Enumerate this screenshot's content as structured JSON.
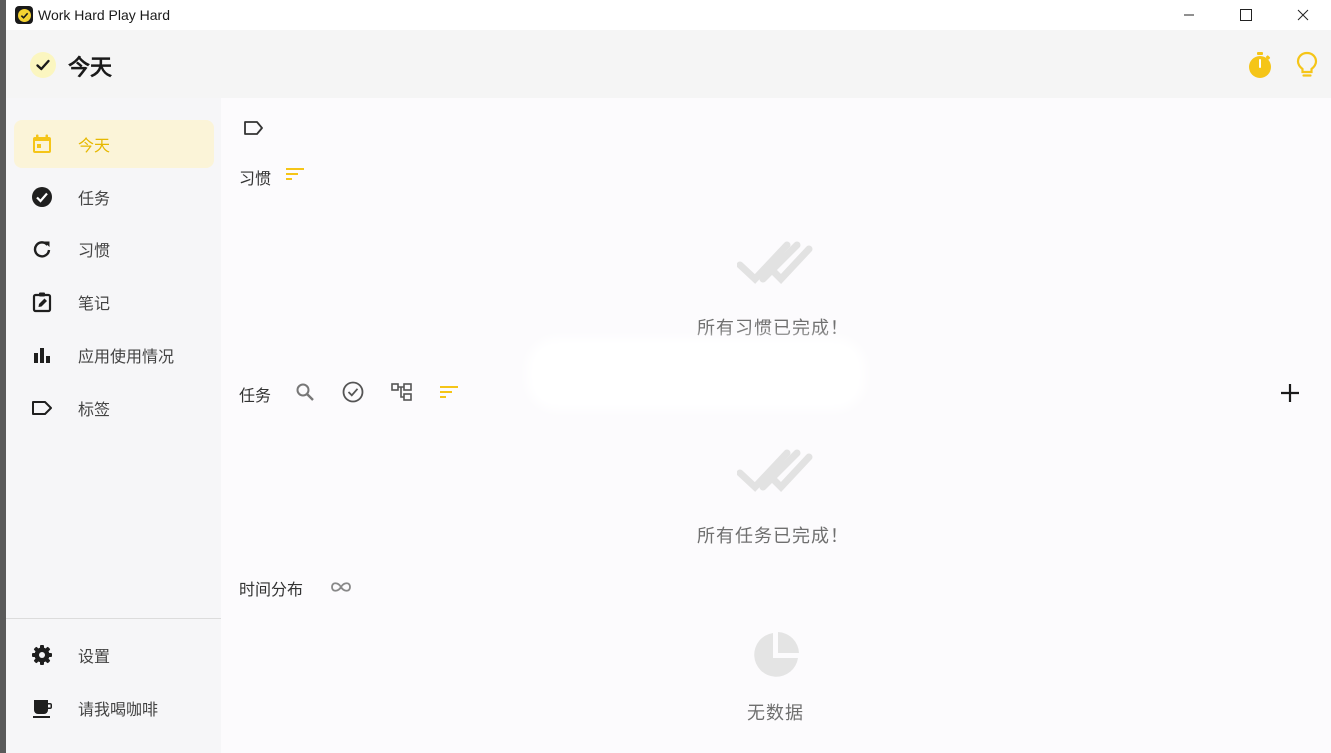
{
  "window": {
    "title": "Work Hard Play Hard"
  },
  "header": {
    "title": "今天",
    "icons": [
      "check-icon",
      "stopwatch-icon",
      "lightbulb-icon"
    ],
    "accent": "#f5c518"
  },
  "sidebar": {
    "items": [
      {
        "label": "今天",
        "icon": "calendar-icon",
        "active": true
      },
      {
        "label": "任务",
        "icon": "check-circle-icon",
        "active": false
      },
      {
        "label": "习惯",
        "icon": "refresh-icon",
        "active": false
      },
      {
        "label": "笔记",
        "icon": "note-edit-icon",
        "active": false
      },
      {
        "label": "应用使用情况",
        "icon": "bar-chart-icon",
        "active": false
      },
      {
        "label": "标签",
        "icon": "tag-icon",
        "active": false
      }
    ],
    "bottom_items": [
      {
        "label": "设置",
        "icon": "gear-icon"
      },
      {
        "label": "请我喝咖啡",
        "icon": "coffee-icon"
      }
    ]
  },
  "main": {
    "habits": {
      "title": "习惯",
      "empty_text": "所有习惯已完成！"
    },
    "tasks": {
      "title": "任务",
      "empty_text": "所有任务已完成！"
    },
    "time_distribution": {
      "title": "时间分布",
      "empty_text": "无数据"
    }
  },
  "colors": {
    "accent": "#f5c518",
    "active_bg": "#fbf4d8",
    "sidebar_bg": "#f6f6f8",
    "header_bg": "#f5f5f5"
  }
}
